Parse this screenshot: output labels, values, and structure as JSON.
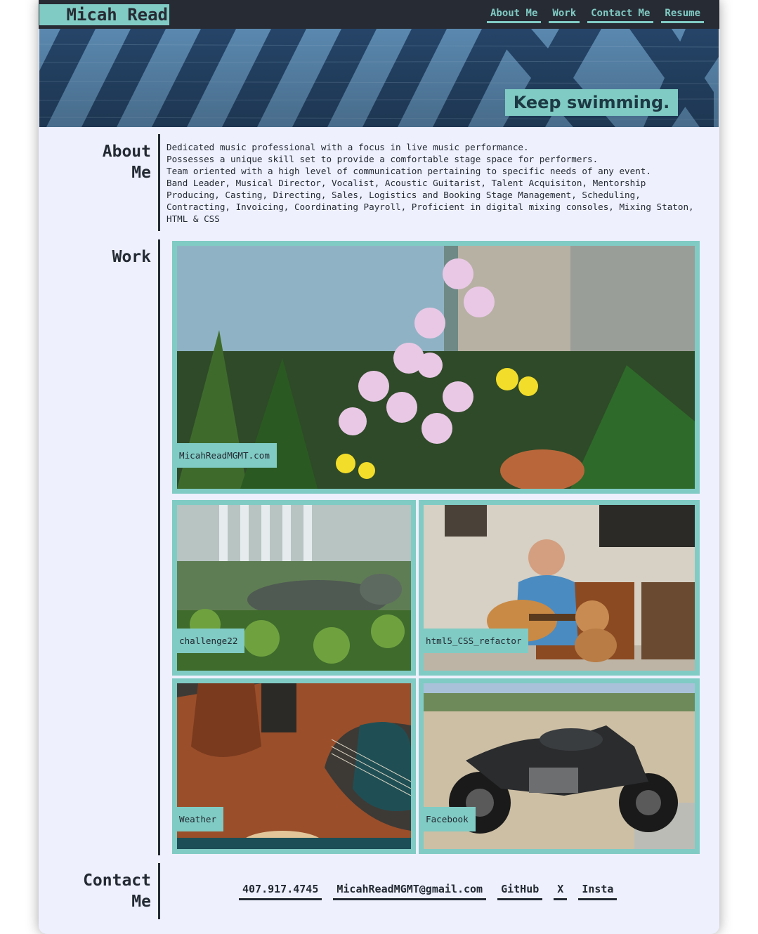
{
  "header": {
    "logo": "Micah Read",
    "nav": [
      {
        "label": "About Me"
      },
      {
        "label": "Work"
      },
      {
        "label": "Contact Me"
      },
      {
        "label": "Resume"
      }
    ]
  },
  "hero": {
    "tagline": "Keep swimming."
  },
  "about": {
    "title_line1": "About",
    "title_line2": "Me",
    "lines": [
      "Dedicated music professional with a focus in live music performance.",
      "Possesses a unique skill set to provide a comfortable stage space for performers.",
      "Team oriented with a high level of communication pertaining to specific needs of any event.",
      "Band Leader, Musical Director, Vocalist, Acoustic Guitarist, Talent Acquisiton, Mentorship",
      "Producing, Casting, Directing, Sales, Logistics and Booking Stage Management, Scheduling,",
      "Contracting, Invoicing, Coordinating Payroll, Proficient in digital mixing consoles, Mixing Staton,",
      "HTML & CSS"
    ]
  },
  "work": {
    "title": "Work",
    "projects": [
      {
        "label": "MicahReadMGMT.com",
        "image": "orchid-plants-photo"
      },
      {
        "label": "challenge22",
        "image": "iguana-photo"
      },
      {
        "label": "html5_CSS_refactor",
        "image": "guitar-player-with-dog-photo"
      },
      {
        "label": "Weather",
        "image": "acoustic-guitars-photo"
      },
      {
        "label": "Facebook",
        "image": "motorcycle-photo"
      }
    ]
  },
  "contact": {
    "title_line1": "Contact",
    "title_line2": "Me",
    "links": [
      {
        "label": "407.917.4745"
      },
      {
        "label": "MicahReadMGMT@gmail.com"
      },
      {
        "label": "GitHub"
      },
      {
        "label": "X"
      },
      {
        "label": "Insta"
      }
    ]
  },
  "colors": {
    "accent": "#80cbc4",
    "dark": "#272b34",
    "page_background": "#eef0fd"
  }
}
